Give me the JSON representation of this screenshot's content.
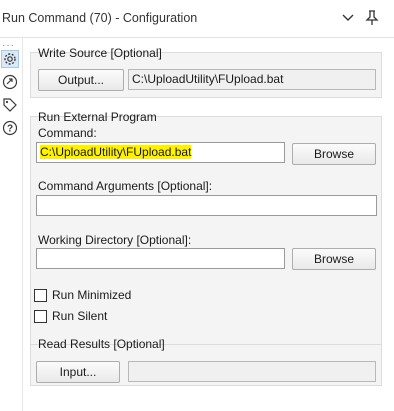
{
  "window": {
    "title": "Run Command (70) - Configuration"
  },
  "rail": {
    "overflow": "···",
    "icons": [
      "gear-icon",
      "connection-icon",
      "tag-icon",
      "help-icon"
    ]
  },
  "write_source": {
    "title": "Write Source [Optional]",
    "button_label": "Output...",
    "value": "C:\\UploadUtility\\FUpload.bat"
  },
  "external_program": {
    "title": "Run External Program",
    "command_label": "Command:",
    "command_value": "C:\\UploadUtility\\FUpload.bat",
    "browse_label": "Browse",
    "args_label": "Command Arguments [Optional]:",
    "args_value": "",
    "workdir_label": "Working Directory [Optional]:",
    "workdir_value": "",
    "workdir_browse_label": "Browse"
  },
  "options": {
    "run_minimized_label": "Run Minimized",
    "run_minimized_checked": false,
    "run_silent_label": "Run Silent",
    "run_silent_checked": false
  },
  "read_results": {
    "title": "Read Results [Optional]",
    "button_label": "Input...",
    "value": ""
  },
  "colors": {
    "highlight": "#fff200",
    "group_bg": "#f4f4f4",
    "active_rail": "#dbe9f7"
  }
}
